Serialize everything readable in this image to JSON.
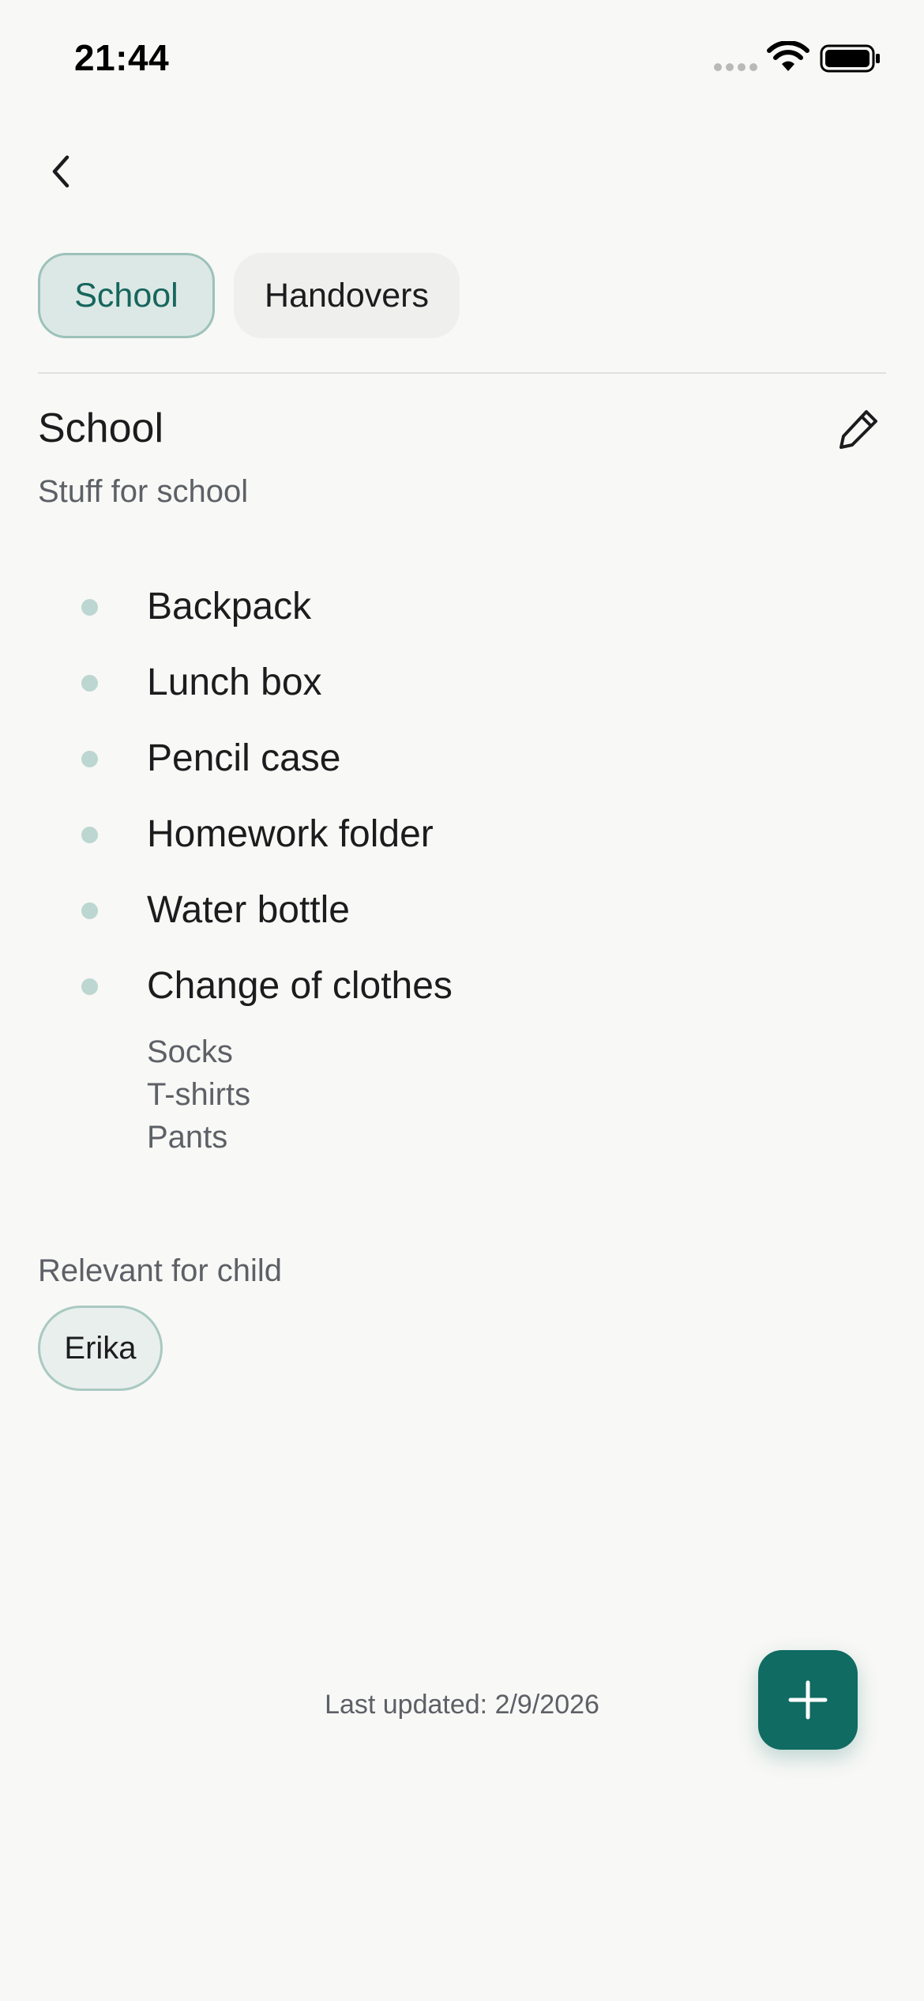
{
  "status_bar": {
    "time": "21:44"
  },
  "tabs": [
    {
      "label": "School",
      "active": true
    },
    {
      "label": "Handovers",
      "active": false
    }
  ],
  "list": {
    "title": "School",
    "description": "Stuff for school",
    "items": [
      {
        "label": "Backpack"
      },
      {
        "label": "Lunch box"
      },
      {
        "label": "Pencil case"
      },
      {
        "label": "Homework folder"
      },
      {
        "label": "Water bottle"
      },
      {
        "label": "Change of clothes",
        "subitems": [
          "Socks",
          "T-shirts",
          "Pants"
        ]
      }
    ]
  },
  "relevant": {
    "label": "Relevant for child",
    "children": [
      "Erika"
    ]
  },
  "footer": {
    "last_updated": "Last updated: 2/9/2026"
  },
  "colors": {
    "accent": "#106b62",
    "active_tab_bg": "#dce8e5",
    "bullet": "#bcd6d1",
    "background": "#f8f8f6"
  },
  "icons": {
    "back": "chevron-left-icon",
    "edit": "pencil-icon",
    "add": "plus-icon"
  }
}
